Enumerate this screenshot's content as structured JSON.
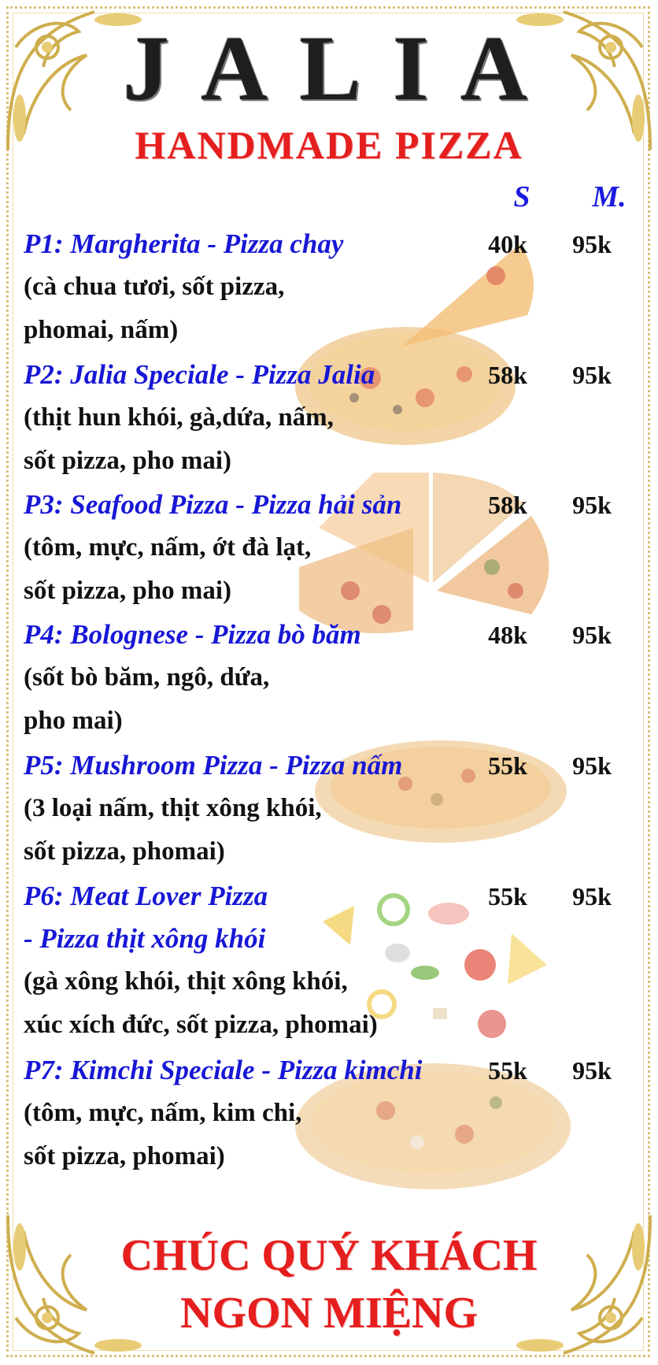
{
  "header": {
    "brand": "JALIA",
    "subtitle": "HANDMADE PIZZA",
    "size_small": "S",
    "size_medium": "M."
  },
  "menu": [
    {
      "title": "P1: Margherita - Pizza chay",
      "desc": [
        "(cà chua tươi, sốt pizza,",
        "phomai, nấm)"
      ],
      "price_s": "40k",
      "price_m": "95k"
    },
    {
      "title": "P2: Jalia Speciale - Pizza Jalia",
      "desc": [
        "(thịt hun khói, gà,dứa, nấm,",
        "sốt pizza, pho mai)"
      ],
      "price_s": "58k",
      "price_m": "95k"
    },
    {
      "title": "P3: Seafood Pizza - Pizza hải sản",
      "desc": [
        "(tôm, mực, nấm, ớt đà lạt,",
        "sốt pizza, pho mai)"
      ],
      "price_s": "58k",
      "price_m": "95k"
    },
    {
      "title": "P4: Bolognese - Pizza bò băm",
      "desc": [
        "(sốt bò băm, ngô, dứa,",
        "pho mai)"
      ],
      "price_s": "48k",
      "price_m": "95k"
    },
    {
      "title": "P5: Mushroom Pizza - Pizza nấm",
      "desc": [
        "(3 loại nấm, thịt xông khói,",
        "sốt pizza, phomai)"
      ],
      "price_s": "55k",
      "price_m": "95k"
    },
    {
      "title": "P6: Meat Lover Pizza",
      "title2": "- Pizza thịt xông khói",
      "desc": [
        "(gà xông khói, thịt xông khói,",
        "xúc xích đức, sốt pizza, phomai)"
      ],
      "price_s": "55k",
      "price_m": "95k"
    },
    {
      "title": "P7: Kimchi Speciale - Pizza kimchi",
      "desc": [
        "(tôm, mực, nấm, kim chi,",
        "sốt pizza, phomai)"
      ],
      "price_s": "55k",
      "price_m": "95k"
    }
  ],
  "footer": {
    "line1": "CHÚC QUÝ KHÁCH",
    "line2": "NGON MIỆNG"
  },
  "colors": {
    "title_blue": "#1717d6",
    "accent_red": "#e51e1e",
    "gold": "#d9c27a"
  }
}
